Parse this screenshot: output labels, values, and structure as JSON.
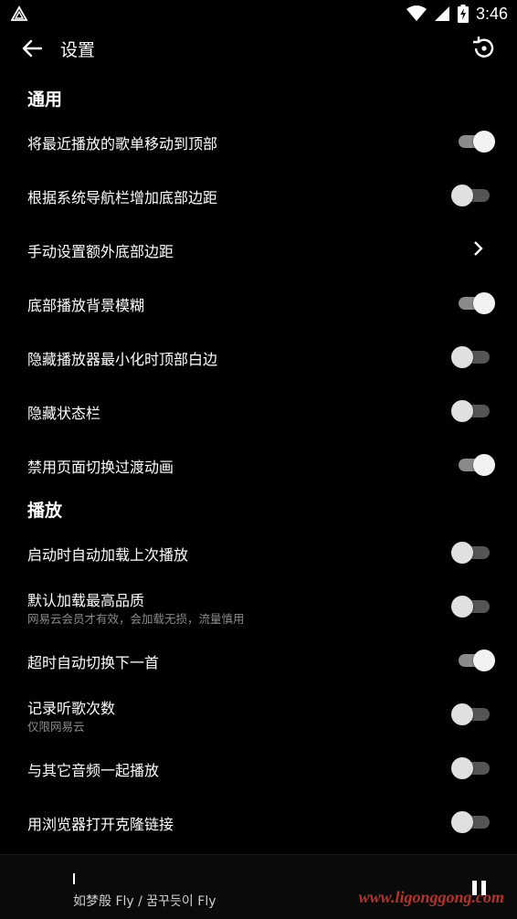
{
  "status_bar": {
    "time": "3:46",
    "left_icon": "app-notification-icon",
    "right_icons": [
      "wifi-icon",
      "cell-signal-icon",
      "battery-charging-icon"
    ]
  },
  "toolbar": {
    "title": "设置",
    "back_icon": "arrow-left-icon",
    "restore_icon": "restore-icon"
  },
  "sections": [
    {
      "title": "通用",
      "items": [
        {
          "title": "将最近播放的歌单移动到顶部",
          "control": "switch",
          "on": true
        },
        {
          "title": "根据系统导航栏增加底部边距",
          "control": "switch",
          "on": false
        },
        {
          "title": "手动设置额外底部边距",
          "control": "chevron"
        },
        {
          "title": "底部播放背景模糊",
          "control": "switch",
          "on": true
        },
        {
          "title": "隐藏播放器最小化时顶部白边",
          "control": "switch",
          "on": false
        },
        {
          "title": "隐藏状态栏",
          "control": "switch",
          "on": false
        },
        {
          "title": "禁用页面切换过渡动画",
          "control": "switch",
          "on": true
        }
      ]
    },
    {
      "title": "播放",
      "items": [
        {
          "title": "启动时自动加载上次播放",
          "control": "switch",
          "on": false
        },
        {
          "title": "默认加载最高品质",
          "subtitle": "网易云会员才有效，会加载无损，流量慎用",
          "control": "switch",
          "on": false
        },
        {
          "title": "超时自动切换下一首",
          "control": "switch",
          "on": true
        },
        {
          "title": "记录听歌次数",
          "subtitle": "仅限网易云",
          "control": "switch",
          "on": false
        },
        {
          "title": "与其它音频一起播放",
          "control": "switch",
          "on": false
        },
        {
          "title": "用浏览器打开克隆链接",
          "control": "switch",
          "on": false
        }
      ]
    }
  ],
  "mini_player": {
    "song": "如梦般 Fly / 꿈꾸듯이 Fly",
    "pause_icon": "pause-icon"
  },
  "watermark": "www.ligonggong.com",
  "colors": {
    "background": "#000000",
    "text": "#ffffff",
    "subtitle": "#8a8a8a",
    "switch_on_track": "#8a8a8a",
    "switch_off_track": "#555555",
    "watermark": "#d33a2e"
  }
}
